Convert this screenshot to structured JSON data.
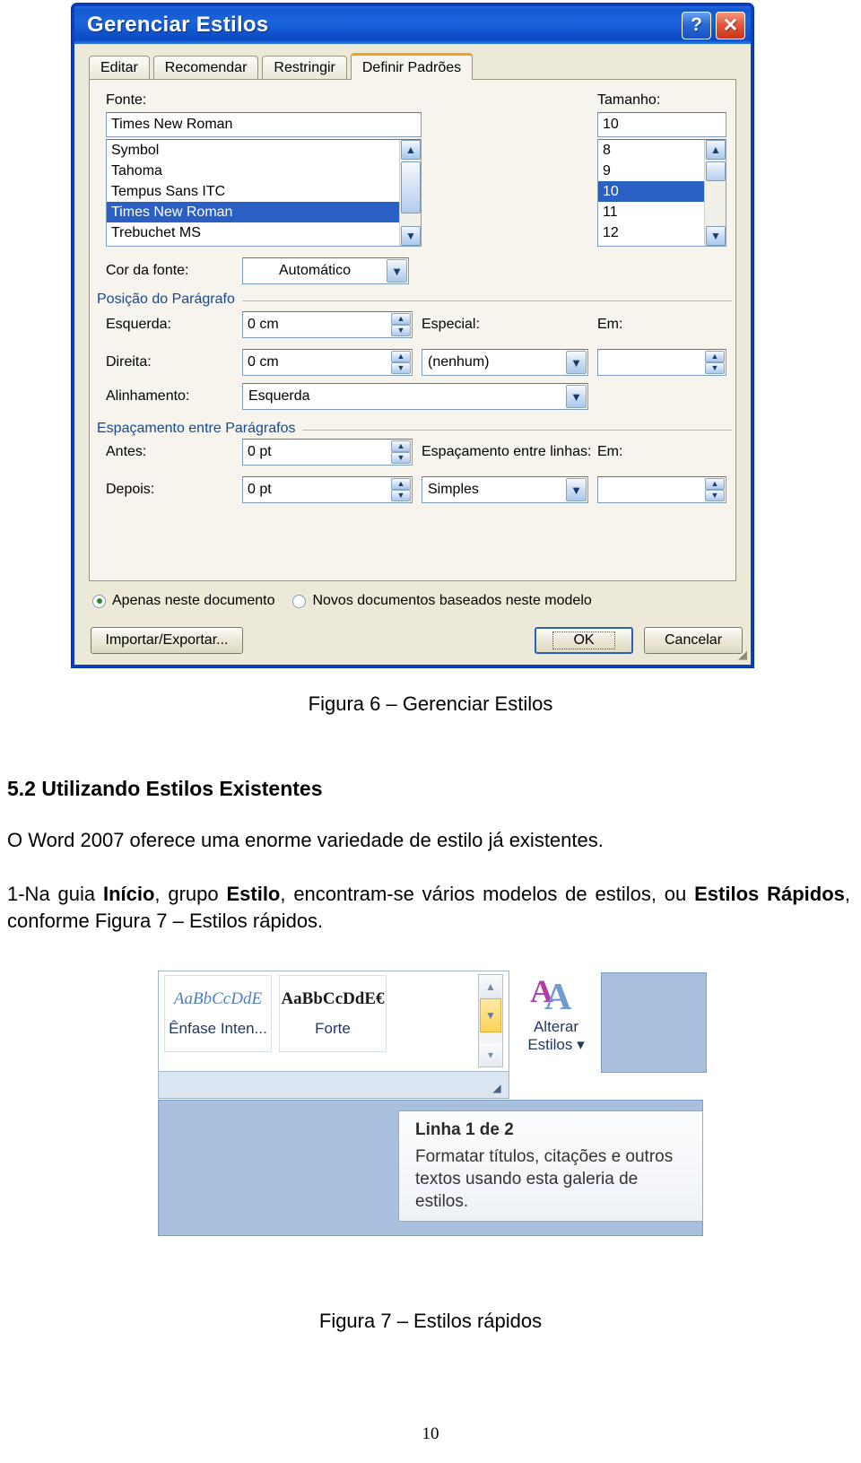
{
  "dialog": {
    "title": "Gerenciar Estilos",
    "help_button": "?",
    "close_button": "✕",
    "tabs": [
      {
        "label": "Editar",
        "active": false
      },
      {
        "label": "Recomendar",
        "active": false
      },
      {
        "label": "Restringir",
        "active": false
      },
      {
        "label": "Definir Padrões",
        "active": true
      }
    ],
    "font": {
      "label": "Fonte:",
      "value": "Times New Roman",
      "options": [
        "Symbol",
        "Tahoma",
        "Tempus Sans ITC",
        "Times New Roman",
        "Trebuchet MS"
      ],
      "selected": "Times New Roman"
    },
    "size": {
      "label": "Tamanho:",
      "value": "10",
      "options": [
        "8",
        "9",
        "10",
        "11",
        "12"
      ],
      "selected": "10"
    },
    "font_color": {
      "label": "Cor da fonte:",
      "value": "Automático"
    },
    "paragraph_position": {
      "group_label": "Posição do Parágrafo",
      "left_label": "Esquerda:",
      "left_value": "0 cm",
      "right_label": "Direita:",
      "right_value": "0 cm",
      "special_label": "Especial:",
      "special_value": "(nenhum)",
      "by_label": "Em:",
      "by_value": "",
      "alignment_label": "Alinhamento:",
      "alignment_value": "Esquerda"
    },
    "paragraph_spacing": {
      "group_label": "Espaçamento entre Parágrafos",
      "before_label": "Antes:",
      "before_value": "0 pt",
      "after_label": "Depois:",
      "after_value": "0 pt",
      "line_spacing_label": "Espaçamento entre linhas:",
      "line_spacing_value": "Simples",
      "at_label": "Em:",
      "at_value": ""
    },
    "scope": {
      "option_doc": "Apenas neste documento",
      "option_template": "Novos documentos baseados neste modelo",
      "selected": "doc"
    },
    "buttons": {
      "import_export": "Importar/Exportar...",
      "ok": "OK",
      "cancel": "Cancelar"
    }
  },
  "document": {
    "figure6_caption": "Figura 6 – Gerenciar Estilos",
    "heading": "5.2 Utilizando Estilos Existentes",
    "paragraph1": "O Word 2007 oferece uma enorme variedade de estilo já existentes.",
    "paragraph2_pre": "1-Na guia ",
    "paragraph2_b1": "Início",
    "paragraph2_mid1": ", grupo ",
    "paragraph2_b2": "Estilo",
    "paragraph2_mid2": ", encontram-se vários modelos de estilos, ou ",
    "paragraph2_b3": "Estilos Rápidos",
    "paragraph2_end": ", conforme Figura 7 – Estilos rápidos.",
    "figure7_caption": "Figura 7 – Estilos rápidos",
    "page_number": "10"
  },
  "figure7": {
    "styles": [
      {
        "preview": "AaBbCcDdE",
        "name": "Ênfase Inten..."
      },
      {
        "preview": "AaBbCcDdE€",
        "name": "Forte"
      }
    ],
    "change_styles_label_line1": "Alterar",
    "change_styles_label_line2": "Estilos",
    "change_styles_icon": "AA",
    "tooltip": {
      "title": "Linha 1 de 2",
      "body": "Formatar títulos, citações e outros textos usando esta galeria de estilos."
    }
  }
}
